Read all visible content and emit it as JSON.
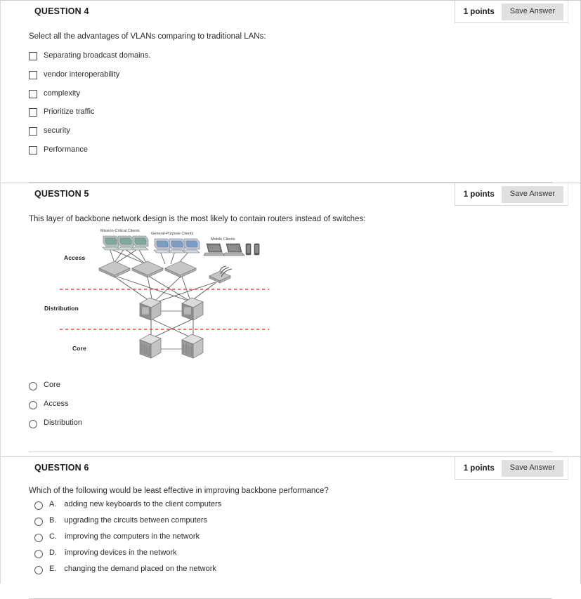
{
  "questions": [
    {
      "id": "q4",
      "title": "QUESTION 4",
      "points_label": "1 points",
      "save_label": "Save Answer",
      "prompt": "Select all the advantages of VLANs comparing to traditional LANs:",
      "input_type": "checkbox",
      "options": [
        "Separating broadcast domains.",
        "vendor interoperability",
        "complexity",
        "Prioritize traffic",
        "security",
        "Performance"
      ]
    },
    {
      "id": "q5",
      "title": "QUESTION 5",
      "points_label": "1 points",
      "save_label": "Save Answer",
      "prompt": "This layer of backbone network design is the most likely to contain routers instead of switches:",
      "input_type": "radio",
      "options": [
        "Core",
        "Access",
        "Distribution"
      ],
      "diagram": {
        "name": "backbone-network-design-diagram",
        "tier_labels": [
          "Access",
          "Distribution",
          "Core"
        ],
        "group_labels": [
          "Mission-Critical Clients",
          "General-Purpose Clients",
          "Mobile Clients"
        ],
        "divider_color": "#e8463c"
      }
    },
    {
      "id": "q6",
      "title": "QUESTION 6",
      "points_label": "1 points",
      "save_label": "Save Answer",
      "prompt": "Which of the following would be least effective in improving backbone performance?",
      "input_type": "radio-lettered",
      "options": [
        {
          "letter": "A.",
          "text": "adding new keyboards to the client computers"
        },
        {
          "letter": "B.",
          "text": "upgrading the circuits between computers"
        },
        {
          "letter": "C.",
          "text": "improving the computers in the network"
        },
        {
          "letter": "D.",
          "text": "improving devices in the network"
        },
        {
          "letter": "E.",
          "text": "changing the demand placed on the network"
        }
      ]
    }
  ],
  "colors": {
    "button_bg": "#e0e0e0",
    "rule": "#cccccc",
    "text": "#262626",
    "diagram_red": "#e8463c"
  }
}
